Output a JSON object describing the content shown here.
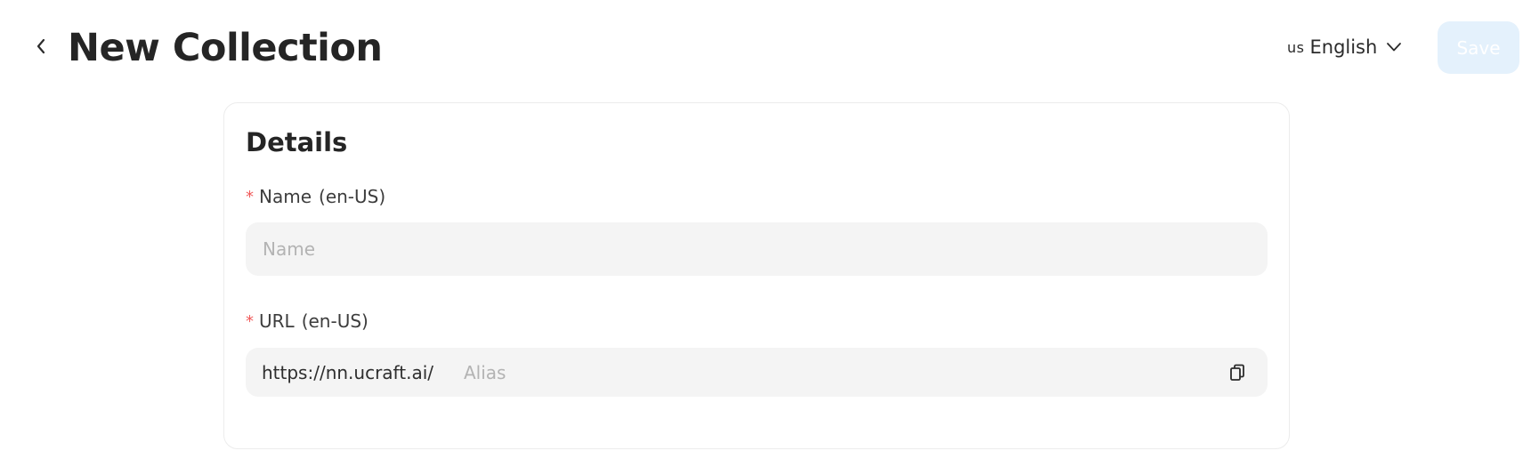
{
  "header": {
    "title": "New Collection",
    "back_icon": "chevron-left-icon",
    "language": {
      "flag_code": "us",
      "label": "English",
      "icon": "chevron-down-icon"
    },
    "save_label": "Save"
  },
  "details": {
    "title": "Details",
    "name_field": {
      "label": "Name",
      "locale": "(en-US)",
      "required_mark": "*",
      "value": "",
      "placeholder": "Name"
    },
    "url_field": {
      "label": "URL",
      "locale": "(en-US)",
      "required_mark": "*",
      "prefix": "https://nn.ucraft.ai/",
      "value": "",
      "placeholder": "Alias",
      "copy_icon": "copy-icon"
    }
  },
  "colors": {
    "save_button_bg": "#e4f1fc",
    "required": "#f05a5a",
    "input_bg": "#f4f4f4"
  }
}
